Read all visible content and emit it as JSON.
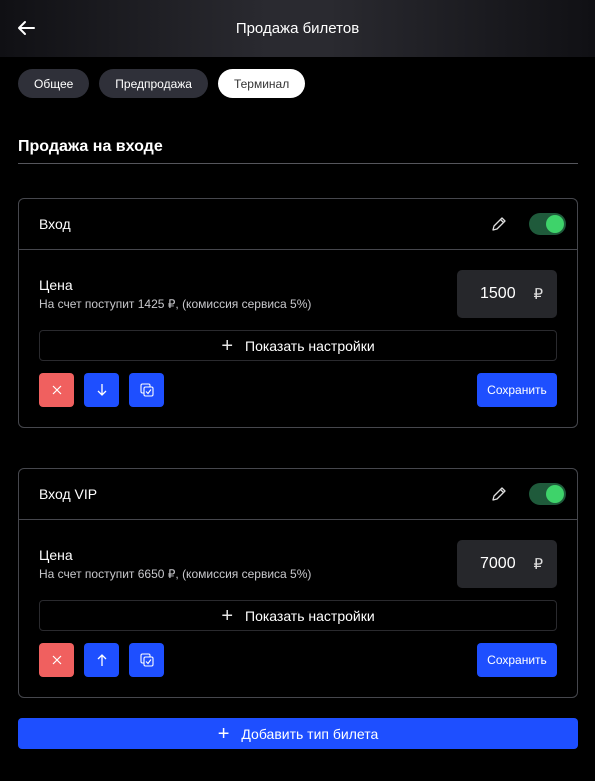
{
  "header": {
    "title": "Продажа билетов",
    "back_icon": "arrow-left-icon"
  },
  "tabs": [
    {
      "label": "Общее",
      "active": false
    },
    {
      "label": "Предпродажа",
      "active": false
    },
    {
      "label": "Терминал",
      "active": true
    }
  ],
  "section": {
    "title": "Продажа на входе"
  },
  "tickets": [
    {
      "name": "Вход",
      "enabled": true,
      "price_label": "Цена",
      "price_note": "На счет поступит 1425 ₽, (комиссия сервиса 5%)",
      "price_value": "1500",
      "currency": "₽",
      "settings_label": "Показать настройки",
      "move_icon": "arrow-down-icon",
      "save_label": "Сохранить"
    },
    {
      "name": "Вход VIP",
      "enabled": true,
      "price_label": "Цена",
      "price_note": "На счет поступит 6650 ₽, (комиссия сервиса 5%)",
      "price_value": "7000",
      "currency": "₽",
      "settings_label": "Показать настройки",
      "move_icon": "arrow-up-icon",
      "save_label": "Сохранить"
    }
  ],
  "add_ticket": {
    "label": "Добавить тип билета"
  },
  "colors": {
    "accent": "#1e4fff",
    "danger": "#f0605f",
    "toggle_on": "#3ed36a"
  }
}
